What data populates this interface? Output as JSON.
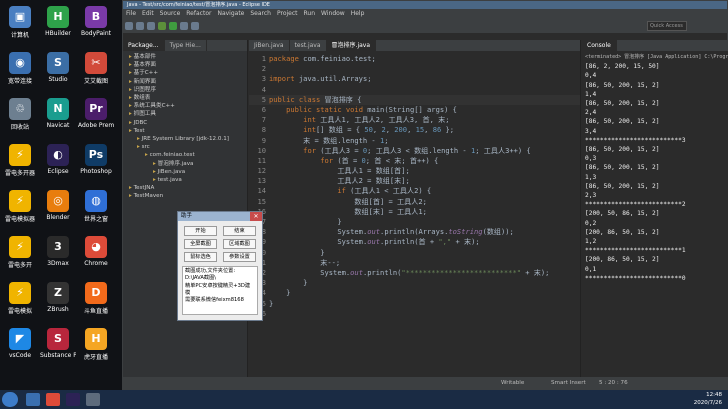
{
  "desktop": {
    "icons": [
      {
        "label": "计算机",
        "color": "#4a7fc1",
        "glyph": "▣"
      },
      {
        "label": "HBuilder",
        "color": "#2ea24a",
        "glyph": "H"
      },
      {
        "label": "BodyPaint",
        "color": "#7a3aa8",
        "glyph": "B"
      },
      {
        "label": "宽带连接",
        "color": "#3a6fb0",
        "glyph": "◉"
      },
      {
        "label": "Studio",
        "color": "#3b6ea5",
        "glyph": "S"
      },
      {
        "label": "艾艾截图",
        "color": "#d24a3a",
        "glyph": "✂"
      },
      {
        "label": "回收站",
        "color": "#6d7f90",
        "glyph": "♲"
      },
      {
        "label": "Navicat",
        "color": "#1a9d8f",
        "glyph": "N"
      },
      {
        "label": "Adobe Premie...",
        "color": "#4b1d6a",
        "glyph": "Pr"
      },
      {
        "label": "雷电多开器",
        "color": "#f0b400",
        "glyph": "⚡"
      },
      {
        "label": "Eclipse",
        "color": "#2c2255",
        "glyph": "◐"
      },
      {
        "label": "Photoshop",
        "color": "#0f3b66",
        "glyph": "Ps"
      },
      {
        "label": "雷电模拟器",
        "color": "#f0b400",
        "glyph": "⚡"
      },
      {
        "label": "Blender",
        "color": "#e87d0d",
        "glyph": "◎"
      },
      {
        "label": "世界之窗",
        "color": "#2f6fd6",
        "glyph": "◍"
      },
      {
        "label": "雷电多开",
        "color": "#f0b400",
        "glyph": "⚡"
      },
      {
        "label": "3Dmax",
        "color": "#2a2a2a",
        "glyph": "3"
      },
      {
        "label": "Chrome",
        "color": "#dd4b39",
        "glyph": "◕"
      },
      {
        "label": "雷电模拟",
        "color": "#f0b400",
        "glyph": "⚡"
      },
      {
        "label": "ZBrush",
        "color": "#333333",
        "glyph": "Z"
      },
      {
        "label": "斗鱼直播",
        "color": "#f26a1b",
        "glyph": "D"
      },
      {
        "label": "vsCode",
        "color": "#1e88e5",
        "glyph": "◤"
      },
      {
        "label": "Substance Painter",
        "color": "#b8263c",
        "glyph": "S"
      },
      {
        "label": "虎牙直播",
        "color": "#f5a623",
        "glyph": "H"
      }
    ]
  },
  "window": {
    "title": "Java - Test/src/com/feiniao/test/冒泡排序.java - Eclipse IDE",
    "menu": [
      "File",
      "Edit",
      "Source",
      "Refactor",
      "Navigate",
      "Search",
      "Project",
      "Run",
      "Window",
      "Help"
    ],
    "quick_access": "Quick Access"
  },
  "package_explorer": {
    "tabs": [
      "Package...",
      "Type Hie..."
    ],
    "tree": [
      "基本部件",
      "基本界面",
      "基于C++",
      "新闻界面",
      "识图程序",
      "数组表",
      "系统工具类C++",
      "抓图工具",
      "JDBC",
      "Test",
      "JRE System Library [jdk-12.0.1]",
      "src",
      "com.feiniao.test",
      "冒泡排序.java",
      "JiBen.java",
      "test.java",
      "TestJNA",
      "TestMaven"
    ]
  },
  "editor": {
    "tabs": [
      "JiBen.java",
      "test.java",
      "冒泡排序.java"
    ],
    "lines": [
      {
        "n": "1",
        "html": "<span class='kw'>package</span> com.feiniao.test;"
      },
      {
        "n": "2",
        "html": ""
      },
      {
        "n": "3",
        "html": "<span class='kw'>import</span> java.util.Arrays;"
      },
      {
        "n": "4",
        "html": ""
      },
      {
        "n": "5",
        "html": "<span class='kw'>public class</span> 冒泡排序 {"
      },
      {
        "n": "6",
        "html": "    <span class='kw'>public static void</span> main(String[] args) {"
      },
      {
        "n": "7",
        "html": "        <span class='kw'>int</span> 工具人1, 工具人2, 工具人3, 首, 末;"
      },
      {
        "n": "8",
        "html": "        <span class='kw'>int</span>[] 数组 = { <span class='num'>50</span>, <span class='num'>2</span>, <span class='num'>200</span>, <span class='num'>15</span>, <span class='num'>86</span> };"
      },
      {
        "n": "9",
        "html": "        末 = 数组.length - <span class='num'>1</span>;"
      },
      {
        "n": "10",
        "html": "        <span class='kw'>for</span> (工具人3 = <span class='num'>0</span>; 工具人3 &lt; 数组.length - <span class='num'>1</span>; 工具人3++) {"
      },
      {
        "n": "11",
        "html": "            <span class='kw'>for</span> (首 = <span class='num'>0</span>; 首 &lt; 末; 首++) {"
      },
      {
        "n": "12",
        "html": "                工具人1 = 数组[首];"
      },
      {
        "n": "13",
        "html": "                工具人2 = 数组[末];"
      },
      {
        "n": "14",
        "html": "                <span class='kw'>if</span> (工具人1 &lt; 工具人2) {"
      },
      {
        "n": "15",
        "html": "                    数组[首] = 工具人2;"
      },
      {
        "n": "16",
        "html": "                    数组[末] = 工具人1;"
      },
      {
        "n": "17",
        "html": "                }"
      },
      {
        "n": "18",
        "html": "                System.<span class='fld'>out</span>.println(Arrays.<span class='fld'>toString</span>(数组));"
      },
      {
        "n": "19",
        "html": "                System.<span class='fld'>out</span>.println(首 + <span class='str'>\",\"</span> + 末);"
      },
      {
        "n": "20",
        "html": "            }"
      },
      {
        "n": "21",
        "html": "            末--;"
      },
      {
        "n": "22",
        "html": "            System.<span class='fld'>out</span>.println(<span class='str'>\"**************************\"</span> + 末);"
      },
      {
        "n": "23",
        "html": "        }"
      },
      {
        "n": "24",
        "html": "    }"
      },
      {
        "n": "25",
        "html": "}"
      },
      {
        "n": "26",
        "html": ""
      }
    ]
  },
  "console": {
    "tab": "Console",
    "terminated": "<terminated> 冒泡排序 [Java Application] C:\\Program F",
    "output": [
      "[86, 2, 200, 15, 50]",
      "0,4",
      "[86, 50, 200, 15, 2]",
      "1,4",
      "[86, 50, 200, 15, 2]",
      "2,4",
      "[86, 50, 200, 15, 2]",
      "3,4",
      "**************************3",
      "[86, 50, 200, 15, 2]",
      "0,3",
      "[86, 50, 200, 15, 2]",
      "1,3",
      "[86, 50, 200, 15, 2]",
      "2,3",
      "**************************2",
      "[200, 50, 86, 15, 2]",
      "0,2",
      "[200, 86, 50, 15, 2]",
      "1,2",
      "**************************1",
      "[200, 86, 50, 15, 2]",
      "0,1",
      "**************************0"
    ]
  },
  "status": {
    "writable": "Writable",
    "insert": "Smart Insert",
    "position": "5 : 20 : 76"
  },
  "dialog": {
    "title": "助手",
    "close": "✕",
    "buttons": [
      "开始",
      "结束",
      "全屏截图",
      "区域截图",
      "鼠标选色",
      "参数设置"
    ],
    "log": [
      "截图成功,文件夹位置:",
      "D:\\JAVA截图\\",
      "精单PC安卓按键精灵+3D建模",
      "需要联系微信feixm8168"
    ]
  },
  "taskbar": {
    "time": "12:48",
    "date": "2020/7/26"
  }
}
